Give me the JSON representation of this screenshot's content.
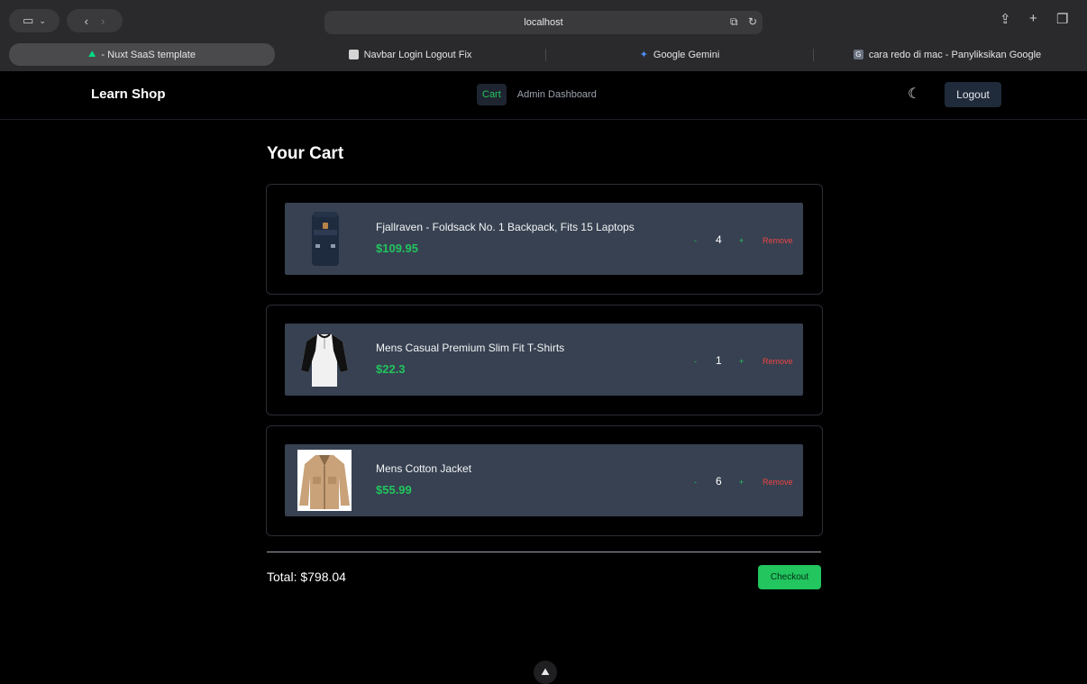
{
  "browser": {
    "url": "localhost",
    "tabs": [
      {
        "label": "- Nuxt SaaS template",
        "active": true,
        "favicon_color": "#00dc82"
      },
      {
        "label": "Navbar Login Logout Fix",
        "active": false,
        "favicon_color": "#d4d4d4"
      },
      {
        "label": "Google Gemini",
        "active": false,
        "favicon_color": "#4f8ef7"
      },
      {
        "label": "cara redo di mac - Panyliksikan Google",
        "active": false,
        "favicon_color": "#6b7280",
        "favicon_letter": "G"
      }
    ]
  },
  "navbar": {
    "brand": "Learn Shop",
    "links": [
      {
        "label": "Cart",
        "active": true
      },
      {
        "label": "Admin Dashboard",
        "active": false
      }
    ],
    "theme_icon": "moon-icon",
    "logout_label": "Logout"
  },
  "cart": {
    "title": "Your Cart",
    "items": [
      {
        "name": "Fjallraven - Foldsack No. 1 Backpack, Fits 15 Laptops",
        "price": "$109.95",
        "minus": "-",
        "quantity": "4",
        "plus": "+",
        "remove": "Remove",
        "image": "backpack"
      },
      {
        "name": "Mens Casual Premium Slim Fit T-Shirts",
        "price": "$22.3",
        "minus": "-",
        "quantity": "1",
        "plus": "+",
        "remove": "Remove",
        "image": "tshirt"
      },
      {
        "name": "Mens Cotton Jacket",
        "price": "$55.99",
        "minus": "-",
        "quantity": "6",
        "plus": "+",
        "remove": "Remove",
        "image": "jacket"
      }
    ],
    "total": "Total: $798.04",
    "checkout_label": "Checkout"
  },
  "colors": {
    "accent_green": "#22c55e",
    "item_bg": "#374151",
    "danger": "#ef4444"
  }
}
